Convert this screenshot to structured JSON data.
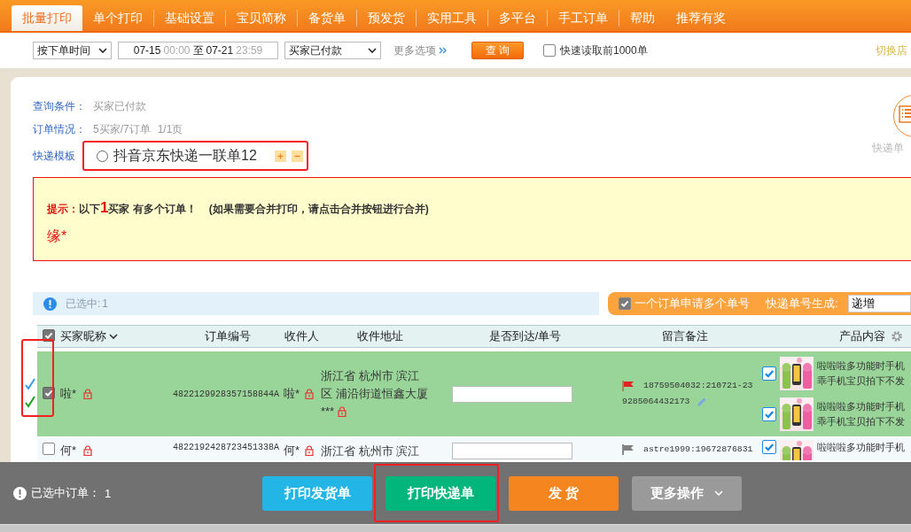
{
  "nav": {
    "tabs": [
      {
        "label": "批量打印",
        "selected": true
      },
      {
        "label": "单个打印",
        "selected": false
      },
      {
        "label": "基础设置",
        "selected": false
      },
      {
        "label": "宝贝简称",
        "selected": false
      },
      {
        "label": "备货单",
        "selected": false
      },
      {
        "label": "预发货",
        "selected": false
      },
      {
        "label": "实用工具",
        "selected": false
      },
      {
        "label": "多平台",
        "selected": false
      },
      {
        "label": "手工订单",
        "selected": false
      },
      {
        "label": "帮助",
        "selected": false
      },
      {
        "label": "推荐有奖",
        "selected": false
      }
    ]
  },
  "filter": {
    "time_type": "按下单时间",
    "date_from": "07-15",
    "time_from": "00:00",
    "separator": "至",
    "date_to": "07-21",
    "time_to": "23:59",
    "status": "买家已付款",
    "more_options": "更多选项",
    "query_button": "查 询",
    "fast_read": {
      "label": "快速读取前1000单",
      "checked": false
    },
    "switch_shop": "切换店"
  },
  "info": {
    "query_label": "查询条件：",
    "query_value": "买家已付款",
    "orders_label": "订单情况：",
    "orders_value": "5买家/7订单",
    "pages": "1/1页",
    "template_label": "快递模板",
    "template": {
      "name": "抖音京东快递一联单12",
      "selected": false,
      "highlighted": true
    },
    "express_settings": "快递单"
  },
  "notice": {
    "prefix": "提示：",
    "before": "以下",
    "count": "1",
    "after": "买家 有多个订单！",
    "hint": "(如果需要合并打印，请点击合并按钮进行合并)",
    "buyer": "缘*"
  },
  "selection": {
    "label": "已选中:",
    "count": "1"
  },
  "multi_number": {
    "label": "一个订单申请多个单号",
    "checked": true,
    "generate_label": "快递单号生成:",
    "generate_value": "递增"
  },
  "table": {
    "all_checked": true,
    "columns": [
      "买家昵称",
      "订单编号",
      "收件人",
      "收件地址",
      "是否到达/单号",
      "留言备注",
      "产品内容"
    ],
    "rows": [
      {
        "selected": true,
        "highlighted": true,
        "invoice_printed": true,
        "express_printed": true,
        "nickname": "啦*",
        "order_no": "4822129928357158844A",
        "receiver": "啦*",
        "address_lines": [
          "浙江省 杭州市 滨江",
          "区 浦沿街道恒鑫大厦",
          "***"
        ],
        "flagged": true,
        "note_lines": [
          "18759504032:210721-23",
          "9285064432173"
        ],
        "products": [
          {
            "checked": true,
            "lines": [
              "啦啦啦多功能时手机",
              "乖手机宝贝拍下不发"
            ]
          },
          {
            "checked": true,
            "lines": [
              "啦啦啦多功能时手机",
              "乖手机宝贝拍下不发"
            ]
          }
        ]
      },
      {
        "selected": false,
        "highlighted": false,
        "invoice_printed": false,
        "express_printed": false,
        "nickname": "何*",
        "order_no": "4822192428723451338A",
        "receiver": "何*",
        "address_lines": [
          "浙江省 杭州市 滨江"
        ],
        "flagged": false,
        "note_lines": [
          "astre1999:19672876831"
        ],
        "products": [
          {
            "checked": true,
            "lines": [
              "啦啦啦多功能时手机"
            ]
          }
        ]
      }
    ]
  },
  "bottom_bar": {
    "label": "已选中订单：",
    "count": "1",
    "buttons": [
      {
        "label": "打印发货单",
        "kind": "print",
        "highlighted": false
      },
      {
        "label": "打印快递单",
        "kind": "express",
        "highlighted": true
      },
      {
        "label": "发 货",
        "kind": "ship",
        "highlighted": false
      },
      {
        "label": "更多操作",
        "kind": "more",
        "highlighted": false
      }
    ]
  }
}
